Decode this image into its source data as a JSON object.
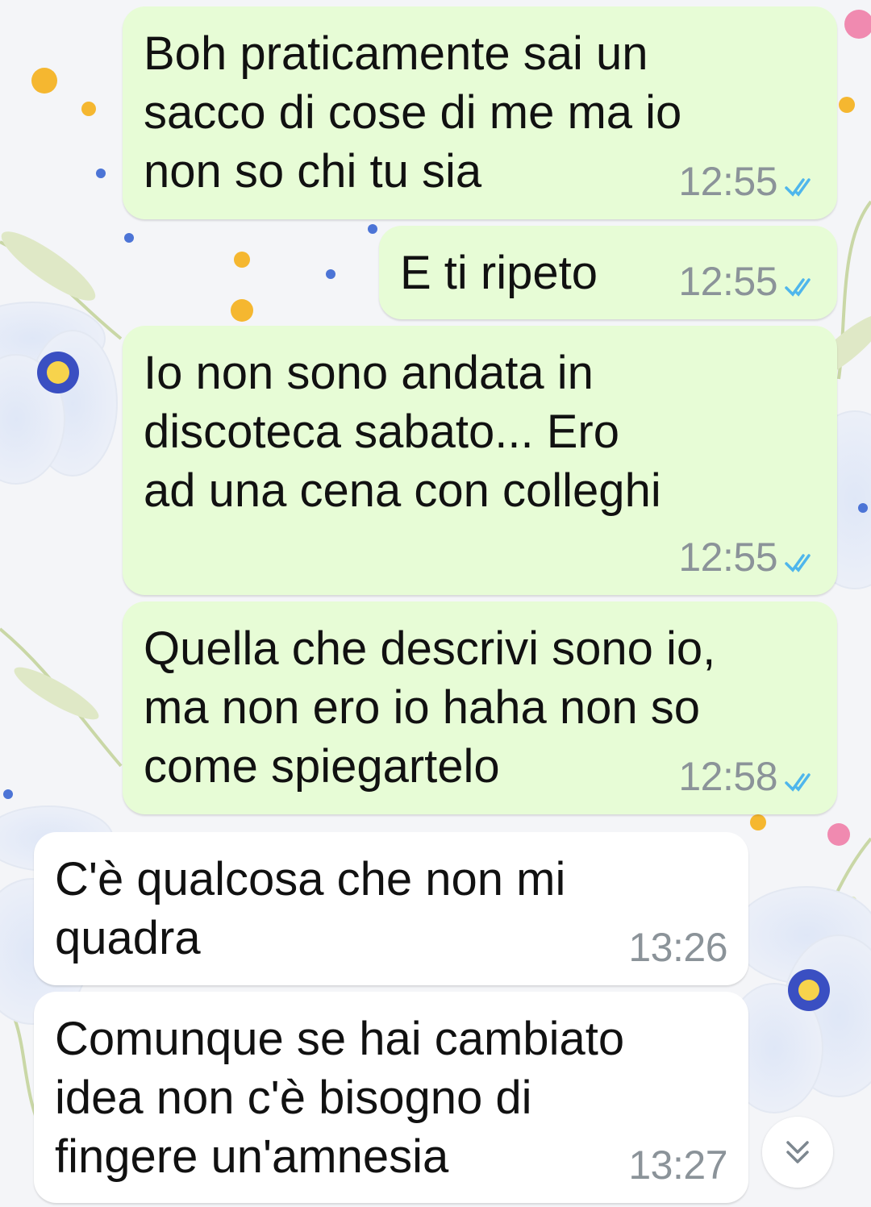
{
  "colors": {
    "outgoing_bubble": "#e7fcd6",
    "incoming_bubble": "#ffffff",
    "timestamp": "#8b9399",
    "read_ticks": "#4fb6ec"
  },
  "messages": [
    {
      "direction": "outgoing",
      "text": "Boh praticamente sai un\nsacco di cose di me ma io\nnon so chi tu sia",
      "time": "12:55",
      "status": "read-ticks-icon"
    },
    {
      "direction": "outgoing",
      "text": "E ti ripeto",
      "time": "12:55",
      "status": "read-ticks-icon"
    },
    {
      "direction": "outgoing",
      "text": "Io non sono andata in\ndiscoteca sabato... Ero\nad una cena con colleghi",
      "time": "12:55",
      "status": "read-ticks-icon"
    },
    {
      "direction": "outgoing",
      "text": "Quella che descrivi sono io,\nma non ero io haha non so\ncome spiegartelo",
      "time": "12:58",
      "status": "read-ticks-icon"
    },
    {
      "direction": "incoming",
      "text": "C'è qualcosa che non mi\nquadra",
      "time": "13:26"
    },
    {
      "direction": "incoming",
      "text": "Comunque se hai cambiato\nidea non c'è bisogno di\nfingere un'amnesia",
      "time": "13:27"
    }
  ],
  "scroll_button": {
    "icon": "double-chevron-down-icon"
  }
}
